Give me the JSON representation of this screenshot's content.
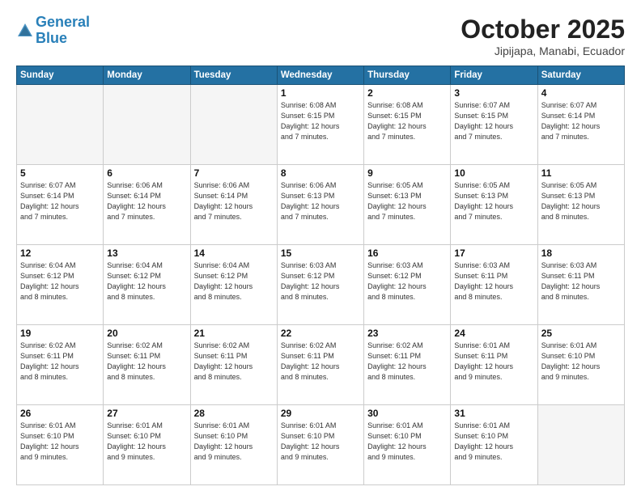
{
  "header": {
    "logo_line1": "General",
    "logo_line2": "Blue",
    "month": "October 2025",
    "location": "Jipijapa, Manabi, Ecuador"
  },
  "weekdays": [
    "Sunday",
    "Monday",
    "Tuesday",
    "Wednesday",
    "Thursday",
    "Friday",
    "Saturday"
  ],
  "weeks": [
    [
      {
        "day": "",
        "info": ""
      },
      {
        "day": "",
        "info": ""
      },
      {
        "day": "",
        "info": ""
      },
      {
        "day": "1",
        "info": "Sunrise: 6:08 AM\nSunset: 6:15 PM\nDaylight: 12 hours\nand 7 minutes."
      },
      {
        "day": "2",
        "info": "Sunrise: 6:08 AM\nSunset: 6:15 PM\nDaylight: 12 hours\nand 7 minutes."
      },
      {
        "day": "3",
        "info": "Sunrise: 6:07 AM\nSunset: 6:15 PM\nDaylight: 12 hours\nand 7 minutes."
      },
      {
        "day": "4",
        "info": "Sunrise: 6:07 AM\nSunset: 6:14 PM\nDaylight: 12 hours\nand 7 minutes."
      }
    ],
    [
      {
        "day": "5",
        "info": "Sunrise: 6:07 AM\nSunset: 6:14 PM\nDaylight: 12 hours\nand 7 minutes."
      },
      {
        "day": "6",
        "info": "Sunrise: 6:06 AM\nSunset: 6:14 PM\nDaylight: 12 hours\nand 7 minutes."
      },
      {
        "day": "7",
        "info": "Sunrise: 6:06 AM\nSunset: 6:14 PM\nDaylight: 12 hours\nand 7 minutes."
      },
      {
        "day": "8",
        "info": "Sunrise: 6:06 AM\nSunset: 6:13 PM\nDaylight: 12 hours\nand 7 minutes."
      },
      {
        "day": "9",
        "info": "Sunrise: 6:05 AM\nSunset: 6:13 PM\nDaylight: 12 hours\nand 7 minutes."
      },
      {
        "day": "10",
        "info": "Sunrise: 6:05 AM\nSunset: 6:13 PM\nDaylight: 12 hours\nand 7 minutes."
      },
      {
        "day": "11",
        "info": "Sunrise: 6:05 AM\nSunset: 6:13 PM\nDaylight: 12 hours\nand 8 minutes."
      }
    ],
    [
      {
        "day": "12",
        "info": "Sunrise: 6:04 AM\nSunset: 6:12 PM\nDaylight: 12 hours\nand 8 minutes."
      },
      {
        "day": "13",
        "info": "Sunrise: 6:04 AM\nSunset: 6:12 PM\nDaylight: 12 hours\nand 8 minutes."
      },
      {
        "day": "14",
        "info": "Sunrise: 6:04 AM\nSunset: 6:12 PM\nDaylight: 12 hours\nand 8 minutes."
      },
      {
        "day": "15",
        "info": "Sunrise: 6:03 AM\nSunset: 6:12 PM\nDaylight: 12 hours\nand 8 minutes."
      },
      {
        "day": "16",
        "info": "Sunrise: 6:03 AM\nSunset: 6:12 PM\nDaylight: 12 hours\nand 8 minutes."
      },
      {
        "day": "17",
        "info": "Sunrise: 6:03 AM\nSunset: 6:11 PM\nDaylight: 12 hours\nand 8 minutes."
      },
      {
        "day": "18",
        "info": "Sunrise: 6:03 AM\nSunset: 6:11 PM\nDaylight: 12 hours\nand 8 minutes."
      }
    ],
    [
      {
        "day": "19",
        "info": "Sunrise: 6:02 AM\nSunset: 6:11 PM\nDaylight: 12 hours\nand 8 minutes."
      },
      {
        "day": "20",
        "info": "Sunrise: 6:02 AM\nSunset: 6:11 PM\nDaylight: 12 hours\nand 8 minutes."
      },
      {
        "day": "21",
        "info": "Sunrise: 6:02 AM\nSunset: 6:11 PM\nDaylight: 12 hours\nand 8 minutes."
      },
      {
        "day": "22",
        "info": "Sunrise: 6:02 AM\nSunset: 6:11 PM\nDaylight: 12 hours\nand 8 minutes."
      },
      {
        "day": "23",
        "info": "Sunrise: 6:02 AM\nSunset: 6:11 PM\nDaylight: 12 hours\nand 8 minutes."
      },
      {
        "day": "24",
        "info": "Sunrise: 6:01 AM\nSunset: 6:11 PM\nDaylight: 12 hours\nand 9 minutes."
      },
      {
        "day": "25",
        "info": "Sunrise: 6:01 AM\nSunset: 6:10 PM\nDaylight: 12 hours\nand 9 minutes."
      }
    ],
    [
      {
        "day": "26",
        "info": "Sunrise: 6:01 AM\nSunset: 6:10 PM\nDaylight: 12 hours\nand 9 minutes."
      },
      {
        "day": "27",
        "info": "Sunrise: 6:01 AM\nSunset: 6:10 PM\nDaylight: 12 hours\nand 9 minutes."
      },
      {
        "day": "28",
        "info": "Sunrise: 6:01 AM\nSunset: 6:10 PM\nDaylight: 12 hours\nand 9 minutes."
      },
      {
        "day": "29",
        "info": "Sunrise: 6:01 AM\nSunset: 6:10 PM\nDaylight: 12 hours\nand 9 minutes."
      },
      {
        "day": "30",
        "info": "Sunrise: 6:01 AM\nSunset: 6:10 PM\nDaylight: 12 hours\nand 9 minutes."
      },
      {
        "day": "31",
        "info": "Sunrise: 6:01 AM\nSunset: 6:10 PM\nDaylight: 12 hours\nand 9 minutes."
      },
      {
        "day": "",
        "info": ""
      }
    ]
  ]
}
